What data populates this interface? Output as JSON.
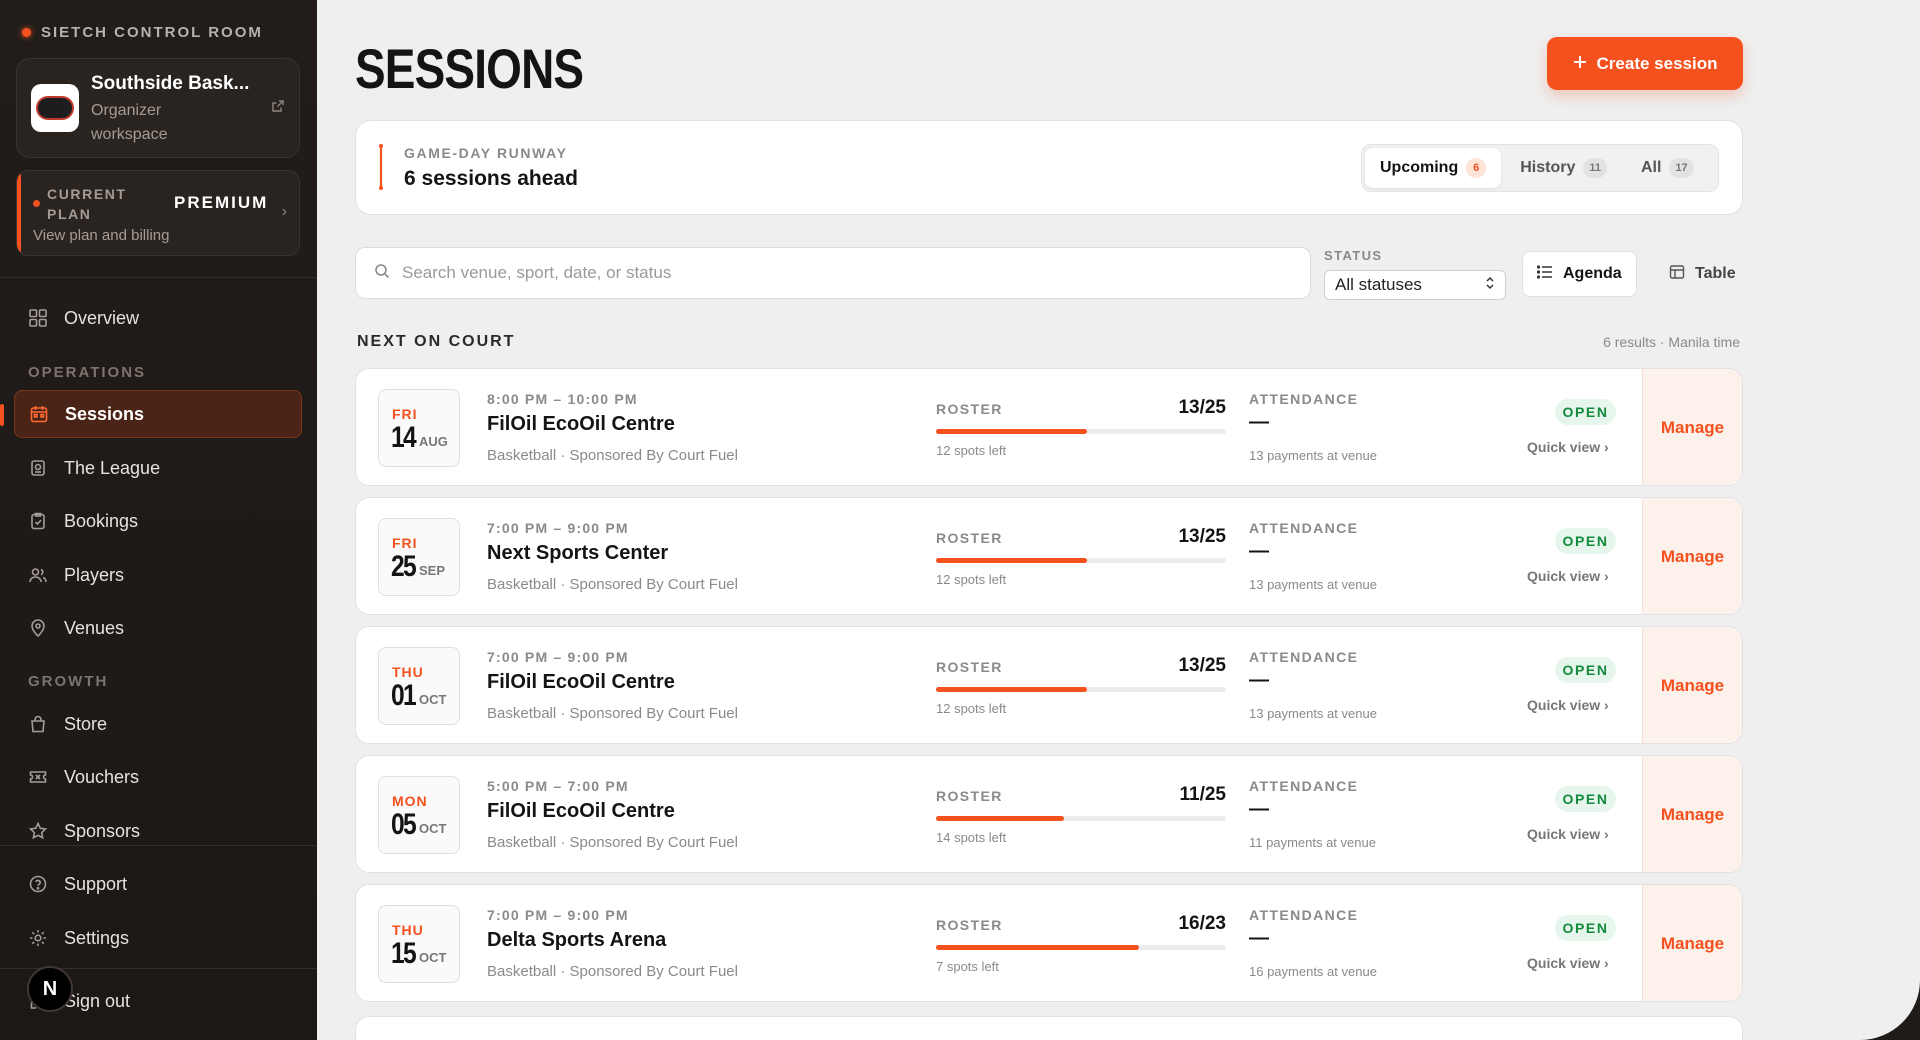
{
  "sidebar": {
    "brand": "SIETCH CONTROL ROOM",
    "org": {
      "name": "Southside Bask...",
      "role": "Organizer workspace"
    },
    "plan": {
      "label": "CURRENT PLAN",
      "name": "PREMIUM",
      "link": "View plan and billing"
    },
    "nav": {
      "overview": "Overview",
      "operations_heading": "OPERATIONS",
      "sessions": "Sessions",
      "league": "The League",
      "bookings": "Bookings",
      "players": "Players",
      "venues": "Venues",
      "growth_heading": "GROWTH",
      "store": "Store",
      "vouchers": "Vouchers",
      "sponsors": "Sponsors",
      "support": "Support",
      "settings": "Settings",
      "sign_out": "Sign out"
    },
    "avatar_initial": "N"
  },
  "header": {
    "title": "SESSIONS",
    "create_label": "Create session"
  },
  "runway": {
    "label": "GAME-DAY RUNWAY",
    "value": "6 sessions ahead",
    "tabs": [
      {
        "label": "Upcoming",
        "count": "6"
      },
      {
        "label": "History",
        "count": "11"
      },
      {
        "label": "All",
        "count": "17"
      }
    ]
  },
  "filters": {
    "search_placeholder": "Search venue, sport, date, or status",
    "status_label": "STATUS",
    "status_value": "All statuses",
    "view_agenda": "Agenda",
    "view_table": "Table"
  },
  "list": {
    "title": "NEXT ON COURT",
    "results": "6 results · Manila time",
    "roster_label": "ROSTER",
    "attendance_label": "ATTENDANCE",
    "quick_view": "Quick view",
    "manage": "Manage",
    "sessions": [
      {
        "dow": "FRI",
        "day": "14",
        "month": "AUG",
        "time": "8:00 PM – 10:00 PM",
        "venue": "FilOil EcoOil Centre",
        "meta": "Basketball · Sponsored By Court Fuel",
        "roster": "13/25",
        "roster_fraction": 0.52,
        "spots": "12 spots left",
        "attendance": "—",
        "payments": "13 payments at venue",
        "status": "OPEN"
      },
      {
        "dow": "FRI",
        "day": "25",
        "month": "SEP",
        "time": "7:00 PM – 9:00 PM",
        "venue": "Next Sports Center",
        "meta": "Basketball · Sponsored By Court Fuel",
        "roster": "13/25",
        "roster_fraction": 0.52,
        "spots": "12 spots left",
        "attendance": "—",
        "payments": "13 payments at venue",
        "status": "OPEN"
      },
      {
        "dow": "THU",
        "day": "01",
        "month": "OCT",
        "time": "7:00 PM – 9:00 PM",
        "venue": "FilOil EcoOil Centre",
        "meta": "Basketball · Sponsored By Court Fuel",
        "roster": "13/25",
        "roster_fraction": 0.52,
        "spots": "12 spots left",
        "attendance": "—",
        "payments": "13 payments at venue",
        "status": "OPEN"
      },
      {
        "dow": "MON",
        "day": "05",
        "month": "OCT",
        "time": "5:00 PM – 7:00 PM",
        "venue": "FilOil EcoOil Centre",
        "meta": "Basketball · Sponsored By Court Fuel",
        "roster": "11/25",
        "roster_fraction": 0.44,
        "spots": "14 spots left",
        "attendance": "—",
        "payments": "11 payments at venue",
        "status": "OPEN"
      },
      {
        "dow": "THU",
        "day": "15",
        "month": "OCT",
        "time": "7:00 PM – 9:00 PM",
        "venue": "Delta Sports Arena",
        "meta": "Basketball · Sponsored By Court Fuel",
        "roster": "16/23",
        "roster_fraction": 0.7,
        "spots": "7 spots left",
        "attendance": "—",
        "payments": "16 payments at venue",
        "status": "OPEN"
      }
    ]
  },
  "colors": {
    "accent": "#f4511e",
    "open": "#138a3c",
    "sidebar": "#1f1b19"
  },
  "icons": [
    "grid-icon",
    "calendar-icon",
    "trophy-icon",
    "clipboard-icon",
    "users-icon",
    "map-pin-icon",
    "bag-icon",
    "ticket-icon",
    "star-icon",
    "help-icon",
    "gear-icon",
    "logout-icon",
    "search-icon",
    "list-icon",
    "table-icon",
    "plus-icon",
    "external-link-icon",
    "chevron-right-icon"
  ]
}
